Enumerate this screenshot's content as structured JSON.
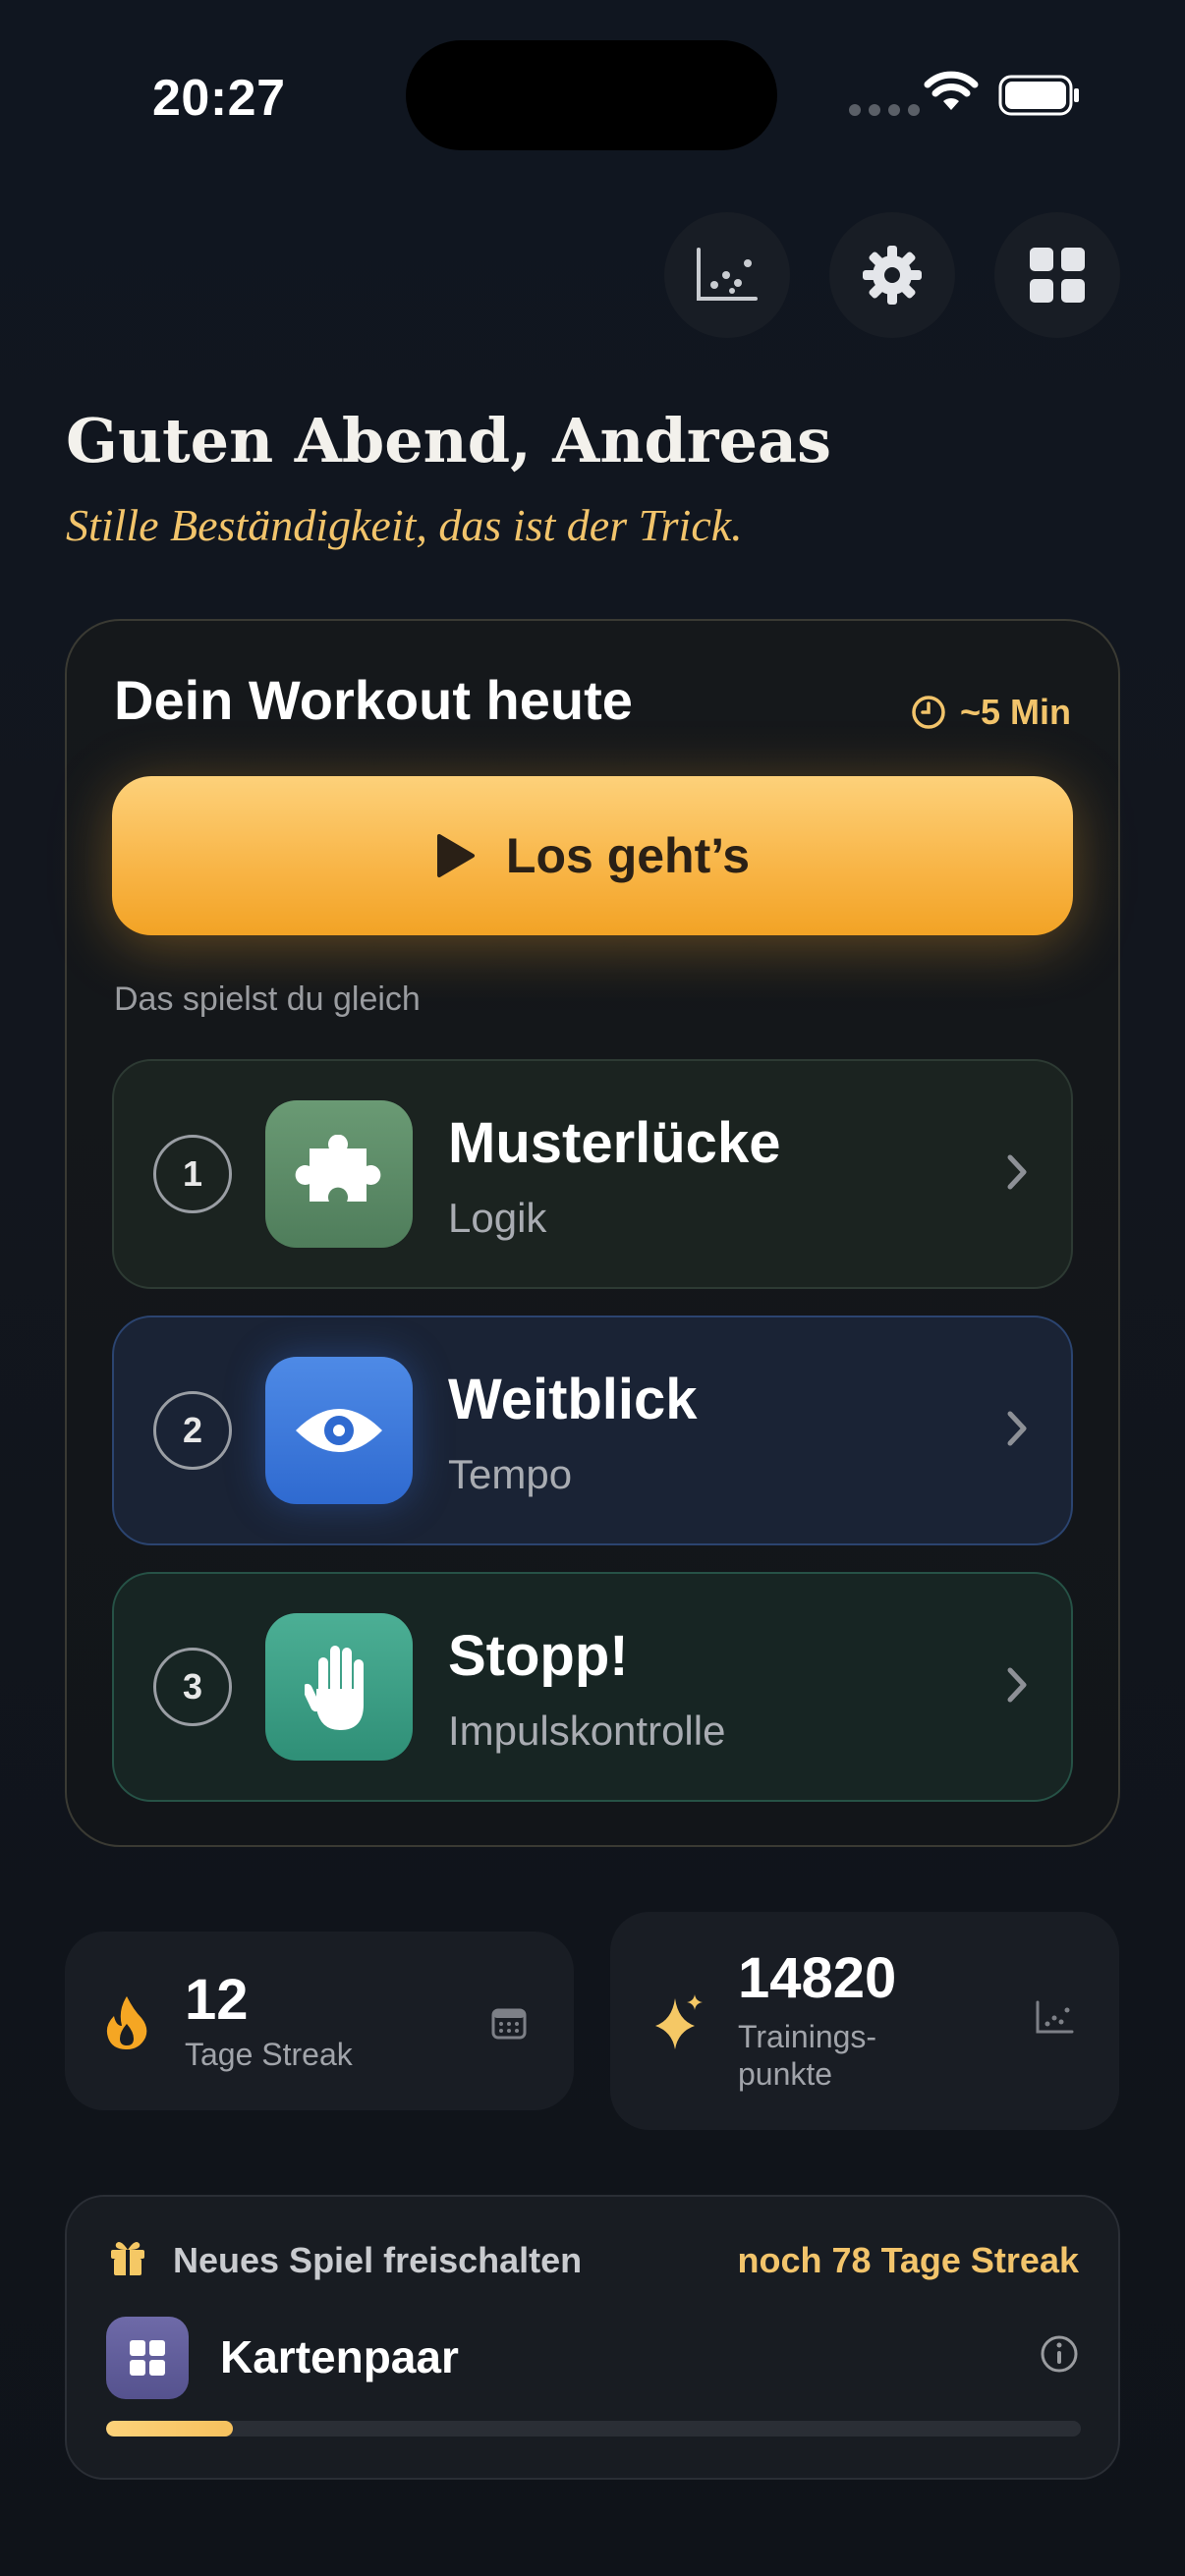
{
  "status_bar": {
    "time": "20:27"
  },
  "header": {
    "icons": [
      "chart-icon",
      "gear-icon",
      "grid-icon"
    ],
    "greeting": "Guten Abend, Andreas",
    "subtitle": "Stille Beständigkeit, das ist der Trick."
  },
  "workout": {
    "title": "Dein Workout heute",
    "duration": "~5 Min",
    "start_label": "Los geht’s",
    "section_label": "Das spielst du gleich",
    "games": [
      {
        "number": "1",
        "name": "Musterlücke",
        "category": "Logik",
        "icon": "puzzle-icon",
        "color": "#5c8c67"
      },
      {
        "number": "2",
        "name": "Weitblick",
        "category": "Tempo",
        "icon": "eye-icon",
        "color": "#3a78e0"
      },
      {
        "number": "3",
        "name": "Stopp!",
        "category": "Impulskontrolle",
        "icon": "hand-icon",
        "color": "#3a9f86"
      }
    ]
  },
  "stats": {
    "streak": {
      "value": "12",
      "label": "Tage Streak",
      "icon": "flame-icon",
      "action_icon": "calendar-icon"
    },
    "points": {
      "value": "14820",
      "label_line1": "Trainings-",
      "label_line2": "punkte",
      "icon": "sparkle-icon",
      "action_icon": "chart-icon"
    }
  },
  "unlock": {
    "title": "Neues Spiel freischalten",
    "remaining": "noch 78 Tage Streak",
    "game_name": "Kartenpaar",
    "progress_fraction": 0.13,
    "accent": "#f6c15e"
  }
}
